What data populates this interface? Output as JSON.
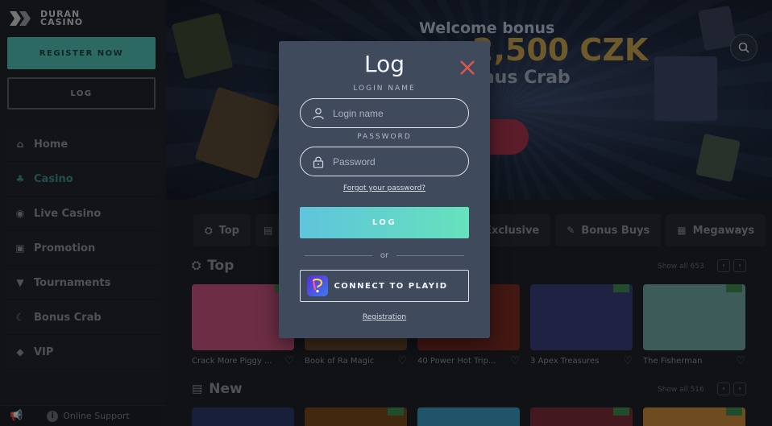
{
  "sidebar": {
    "logo_line1": "DURAN",
    "logo_line2": "CASINO",
    "register_label": "REGISTER NOW",
    "log_label": "LOG",
    "items": [
      {
        "label": "Home",
        "icon": "home-icon"
      },
      {
        "label": "Casino",
        "icon": "casino-icon",
        "active": true
      },
      {
        "label": "Live Casino",
        "icon": "live-casino-icon"
      },
      {
        "label": "Promotion",
        "icon": "gift-icon"
      },
      {
        "label": "Tournaments",
        "icon": "trophy-icon"
      },
      {
        "label": "Bonus Crab",
        "icon": "crab-claw-icon"
      },
      {
        "label": "VIP",
        "icon": "diamond-icon"
      }
    ],
    "footer": {
      "support_label": "Online Support"
    }
  },
  "banner": {
    "title": "Welcome bonus",
    "amount": "2,500 CZK",
    "subtitle": "nus Crab"
  },
  "categories": [
    {
      "label": "Top",
      "icon": "top-icon"
    },
    {
      "label": "",
      "icon": "new-icon"
    },
    {
      "label": "Exclusive",
      "icon": "exclusive-icon"
    },
    {
      "label": "Bonus Buys",
      "icon": "bonus-buys-icon"
    },
    {
      "label": "Megaways",
      "icon": "megaways-icon"
    }
  ],
  "sections": {
    "top": {
      "title": "Top",
      "show_all": "Show all 653"
    },
    "new": {
      "title": "New",
      "show_all": "Show all 516"
    }
  },
  "games_top": [
    {
      "name": "Crack More Piggy ...",
      "new": true,
      "color": "#c7537f"
    },
    {
      "name": "Book of Ra Magic",
      "new": false,
      "color": "#6b4a2e"
    },
    {
      "name": "40 Power Hot Trip...",
      "new": false,
      "color": "#7a2a22"
    },
    {
      "name": "3 Apex Treasures",
      "new": true,
      "color": "#3a3f7a"
    },
    {
      "name": "The Fisherman",
      "new": true,
      "color": "#6fa7a3"
    }
  ],
  "games_new_colors": [
    "#2a3a6a",
    "#7a4a1e",
    "#3a9ac0",
    "#7a2f3a",
    "#c98a3a"
  ],
  "modal": {
    "title": "Log",
    "login_label": "LOGIN NAME",
    "login_placeholder": "Login name",
    "password_label": "PASSWORD",
    "password_placeholder": "Password",
    "forgot": "Forgot your password?",
    "log_button": "LOG",
    "or": "or",
    "connect": "CONNECT TO PLAYID",
    "registration": "Registration"
  }
}
